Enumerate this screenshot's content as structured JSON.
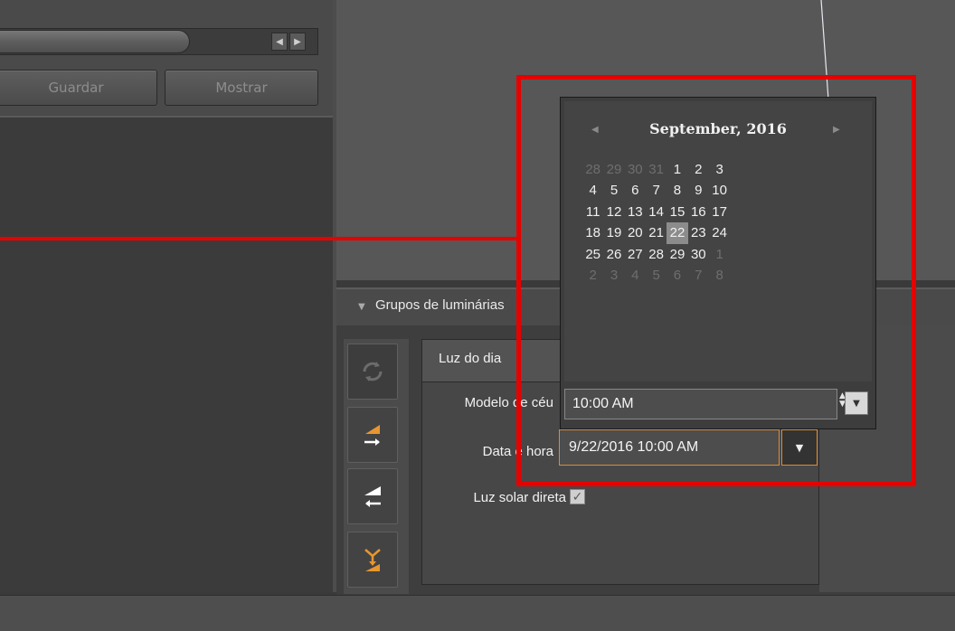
{
  "left_panel": {
    "buttons": {
      "guardar": "Guardar",
      "mostrar": "Mostrar"
    },
    "scroll": {
      "left_icon": "◀",
      "right_icon": "▶"
    }
  },
  "groups_panel": {
    "title": "Grupos de luminárias",
    "collapse_icon": "▼",
    "detail": {
      "title": "Luz do dia",
      "sky_model_label": "Modelo de céu",
      "date_time_label": "Data e hora",
      "date_time_value": "9/22/2016 10:00 AM",
      "direct_sunlight_label": "Luz solar direta",
      "direct_sunlight_checked": true
    }
  },
  "calendar": {
    "title": "September, 2016",
    "prev_icon": "◀",
    "next_icon": "▶",
    "weeks": [
      [
        {
          "d": "28",
          "m": true
        },
        {
          "d": "29",
          "m": true
        },
        {
          "d": "30",
          "m": true
        },
        {
          "d": "31",
          "m": true
        },
        {
          "d": "1"
        },
        {
          "d": "2"
        },
        {
          "d": "3"
        }
      ],
      [
        {
          "d": "4"
        },
        {
          "d": "5"
        },
        {
          "d": "6"
        },
        {
          "d": "7"
        },
        {
          "d": "8"
        },
        {
          "d": "9"
        },
        {
          "d": "10"
        }
      ],
      [
        {
          "d": "11"
        },
        {
          "d": "12"
        },
        {
          "d": "13"
        },
        {
          "d": "14"
        },
        {
          "d": "15"
        },
        {
          "d": "16"
        },
        {
          "d": "17"
        }
      ],
      [
        {
          "d": "18"
        },
        {
          "d": "19"
        },
        {
          "d": "20"
        },
        {
          "d": "21"
        },
        {
          "d": "22",
          "s": true
        },
        {
          "d": "23"
        },
        {
          "d": "24"
        }
      ],
      [
        {
          "d": "25"
        },
        {
          "d": "26"
        },
        {
          "d": "27"
        },
        {
          "d": "28"
        },
        {
          "d": "29"
        },
        {
          "d": "30"
        },
        {
          "d": "1",
          "m": true
        }
      ],
      [
        {
          "d": "2",
          "m": true
        },
        {
          "d": "3",
          "m": true
        },
        {
          "d": "4",
          "m": true
        },
        {
          "d": "5",
          "m": true
        },
        {
          "d": "6",
          "m": true
        },
        {
          "d": "7",
          "m": true
        },
        {
          "d": "8",
          "m": true
        }
      ]
    ],
    "selected_day": "22",
    "time_value": "10:00 AM"
  },
  "colors": {
    "accent": "#e08a2e",
    "annotation": "#e60000",
    "sidebar_icon_orange": "#e8962e"
  }
}
